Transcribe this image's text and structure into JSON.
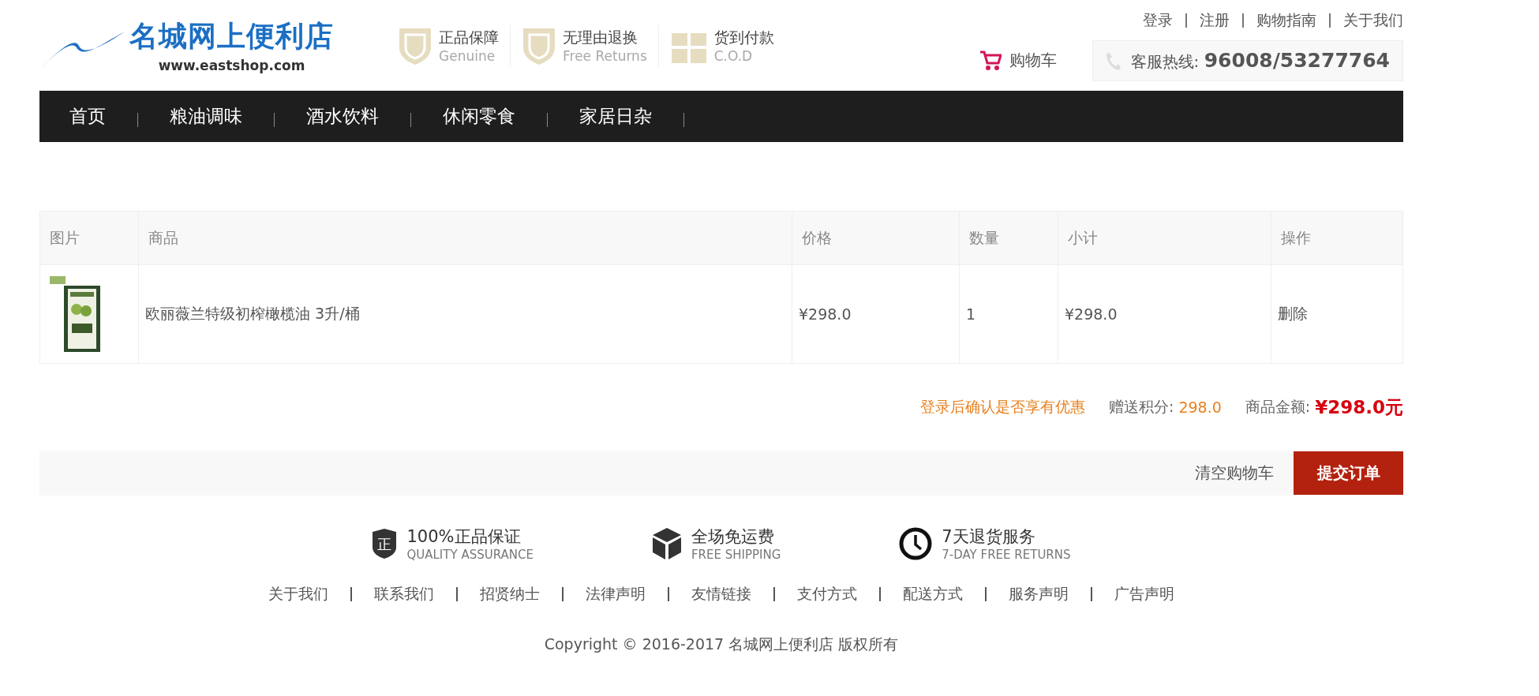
{
  "header": {
    "logo": {
      "title": "名城网上便利店",
      "url": "www.eastshop.com"
    },
    "badges": [
      {
        "kind": "shield",
        "title": "正品保障",
        "subtitle": "Genuine"
      },
      {
        "kind": "shield",
        "title": "无理由退换",
        "subtitle": "Free Returns"
      },
      {
        "kind": "gift",
        "title": "货到付款",
        "subtitle": "C.O.D"
      }
    ],
    "top_links": [
      "登录",
      "注册",
      "购物指南",
      "关于我们"
    ],
    "cart": {
      "label": "购物车"
    },
    "hotline": "客服热线: **96008/53277764**"
  },
  "nav": [
    {
      "label": "首页"
    },
    {
      "label": "粮油调味"
    },
    {
      "label": "酒水饮料"
    },
    {
      "label": "休闲零食"
    },
    {
      "label": "家居日杂"
    }
  ],
  "table": {
    "columns": [
      "图片",
      "商品",
      "价格",
      "数量",
      "小计",
      "操作"
    ],
    "rows": [
      {
        "product": "欧丽薇兰特级初榨橄榄油 3升/桶",
        "price": "¥298.0",
        "quantity": "1",
        "subtotal": "¥298.0",
        "action": "删除"
      }
    ]
  },
  "summary": {
    "notice": "登录后确认是否享有优惠",
    "points_label": "赠送积分:",
    "points": "298.0",
    "total_label": "商品金额:",
    "total": "¥298.0元"
  },
  "actions": {
    "clear": "清空购物车",
    "submit": "提交订单"
  },
  "footer": {
    "badges": [
      {
        "kind": "shield",
        "icon_char": "正",
        "title": "100%正品保证",
        "subtitle": "QUALITY ASSURANCE"
      },
      {
        "kind": "box",
        "title": "全场免运费",
        "subtitle": "FREE SHIPPING"
      },
      {
        "kind": "clock",
        "title": "7天退货服务",
        "subtitle": "7-DAY FREE RETURNS"
      }
    ],
    "links": [
      "关于我们",
      "联系我们",
      "招贤纳士",
      "法律声明",
      "友情链接",
      "支付方式",
      "配送方式",
      "服务声明",
      "广告声明"
    ],
    "copyright": "Copyright © 2016-2017 名城网上便利店 版权所有"
  }
}
